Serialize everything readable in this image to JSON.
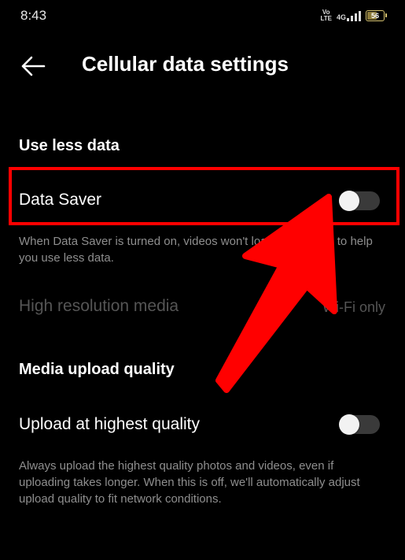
{
  "status_bar": {
    "time": "8:43",
    "volte_top": "Vo",
    "volte_bottom": "LTE",
    "network": "4G",
    "battery": "56"
  },
  "header": {
    "title": "Cellular data settings",
    "back_icon": "arrow-left-icon"
  },
  "use_less_data": {
    "heading": "Use less data",
    "data_saver": {
      "label": "Data Saver",
      "enabled": false,
      "description": "When Data Saver is turned on, videos won't load in advance to help you use less data."
    },
    "high_res_media": {
      "label": "High resolution media",
      "value": "Wi-Fi only"
    }
  },
  "media_upload": {
    "heading": "Media upload quality",
    "upload_highest": {
      "label": "Upload at highest quality",
      "enabled": false,
      "description": "Always upload the highest quality photos and videos, even if uploading takes longer. When this is off, we'll automatically adjust upload quality to fit network conditions."
    }
  },
  "annotation": {
    "highlight_color": "#ff0000",
    "arrow_color": "#ff0000"
  }
}
